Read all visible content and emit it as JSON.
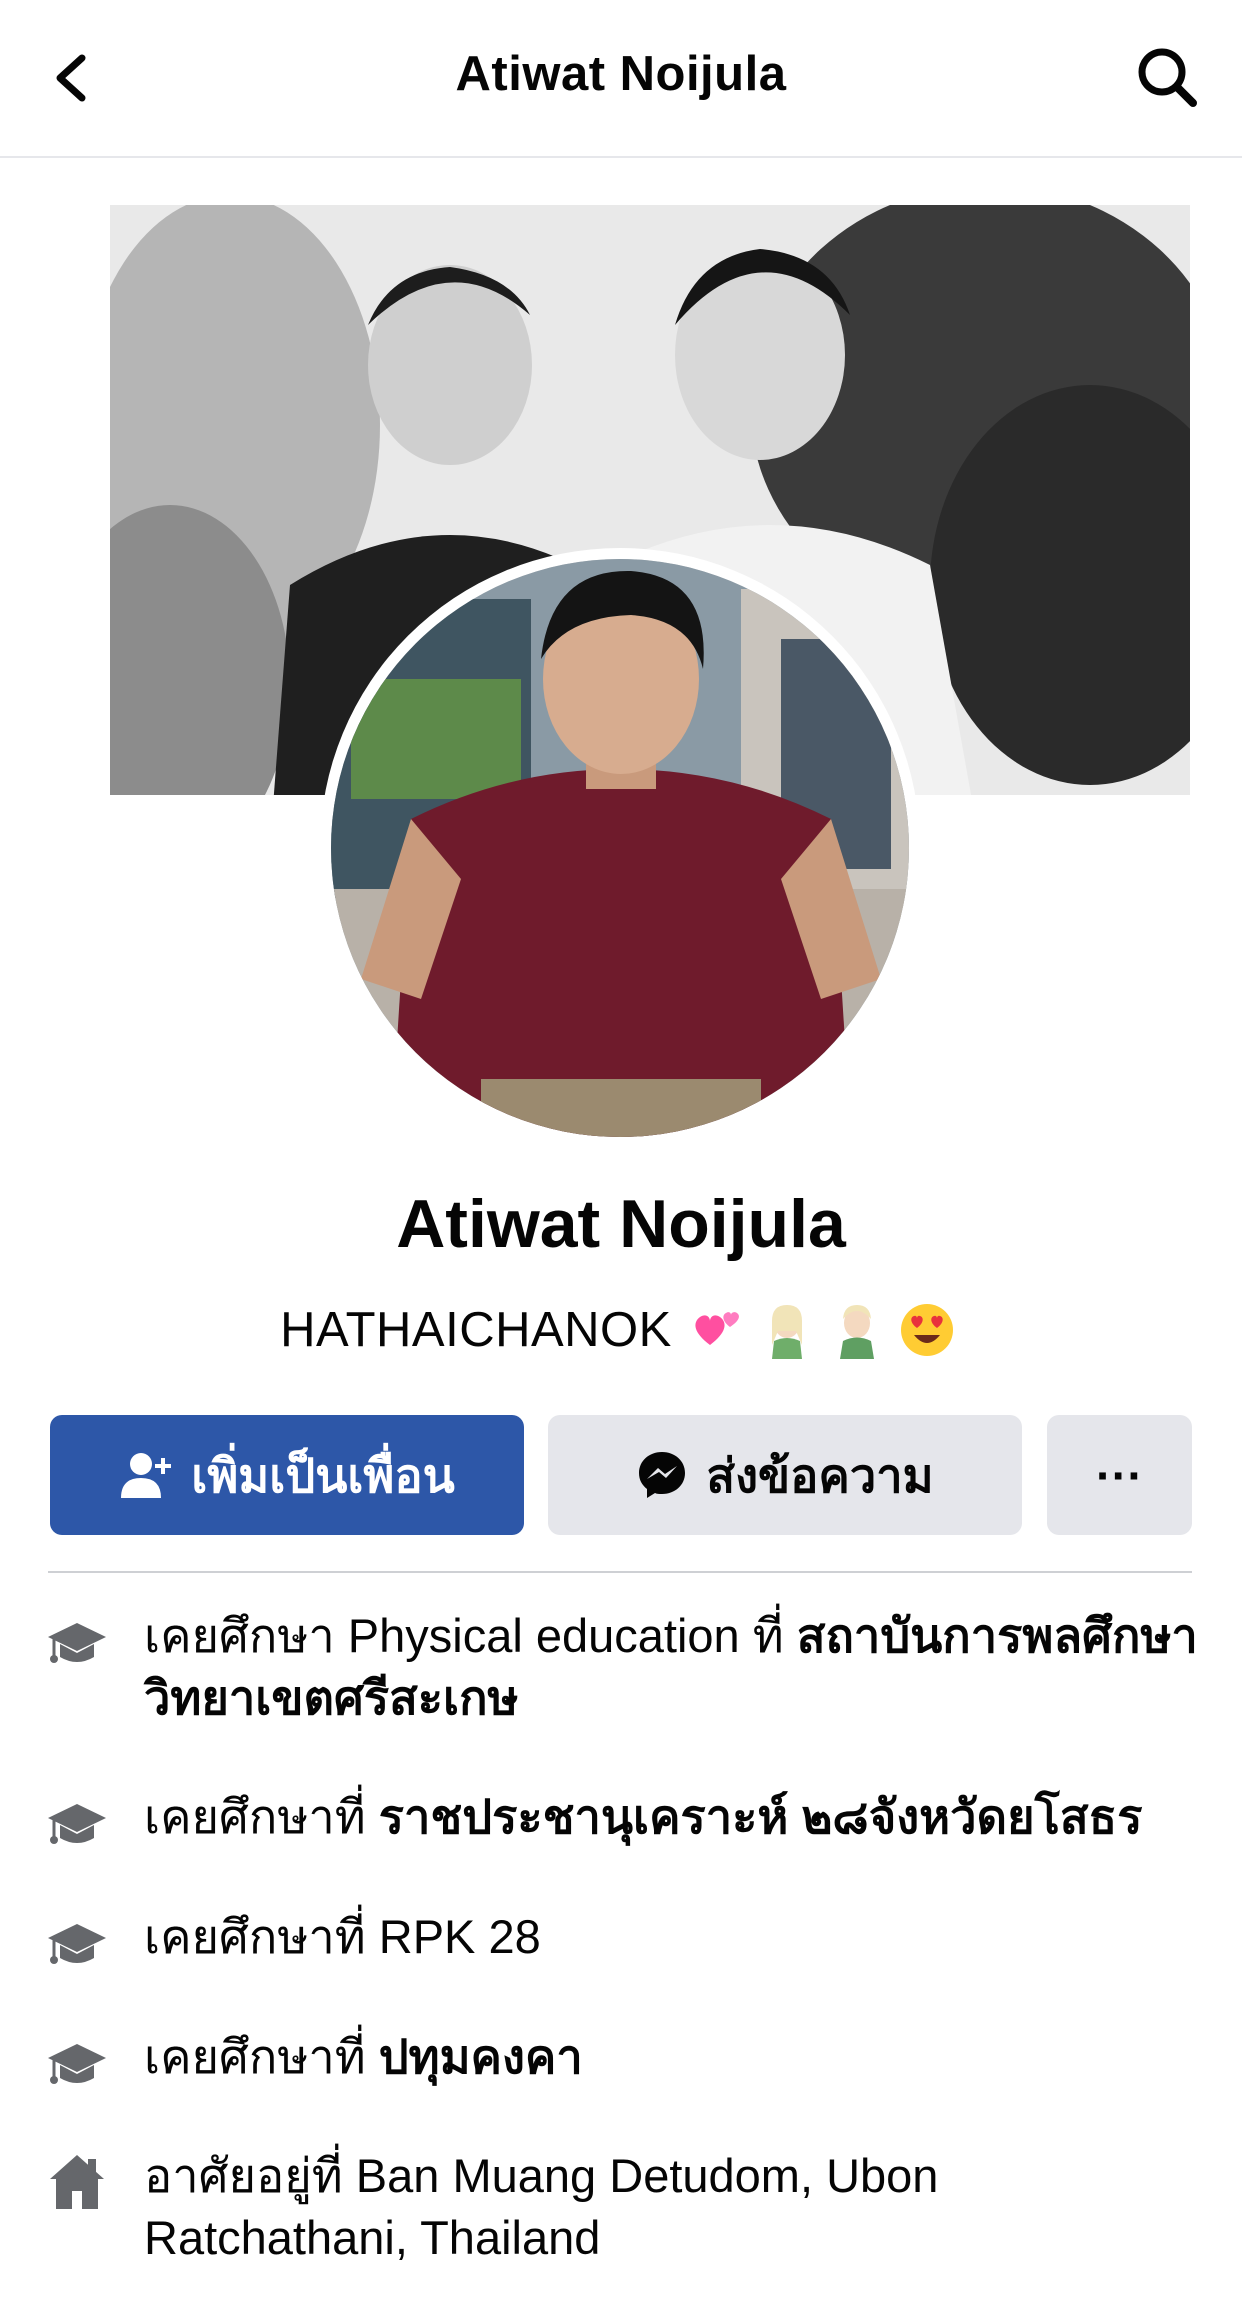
{
  "header": {
    "title": "Atiwat Noijula",
    "back_icon": "chevron-left-icon",
    "search_icon": "search-icon"
  },
  "profile": {
    "name": "Atiwat Noijula",
    "bio_text": "HATHAICHANOK",
    "bio_emojis": [
      "two-hearts-emoji",
      "elf-woman-emoji",
      "elf-man-emoji",
      "heart-eyes-emoji"
    ]
  },
  "actions": {
    "add_friend_label": "เพิ่มเป็นเพื่อน",
    "message_label": "ส่งข้อความ",
    "more_label": "···"
  },
  "colors": {
    "primary": "#2d57a8",
    "secondary_button": "#e5e6eb",
    "icon_gray": "#65676b"
  },
  "details": [
    {
      "icon": "graduation-cap-icon",
      "prefix": "เคยศึกษา Physical education ที่ ",
      "bold": "สถาบันการพลศึกษา วิทยาเขตศรีสะเกษ"
    },
    {
      "icon": "graduation-cap-icon",
      "prefix": "เคยศึกษาที่ ",
      "bold": "ราชประชานุเคราะห์ ๒๘จังหวัดยโสธร"
    },
    {
      "icon": "graduation-cap-icon",
      "prefix": "เคยศึกษาที่ RPK 28",
      "bold": ""
    },
    {
      "icon": "graduation-cap-icon",
      "prefix": "เคยศึกษาที่ ",
      "bold": "ปทุมคงคา"
    },
    {
      "icon": "home-icon",
      "prefix": "อาศัยอยู่ที่ Ban Muang Detudom, Ubon Ratchathani, Thailand",
      "bold": ""
    }
  ]
}
